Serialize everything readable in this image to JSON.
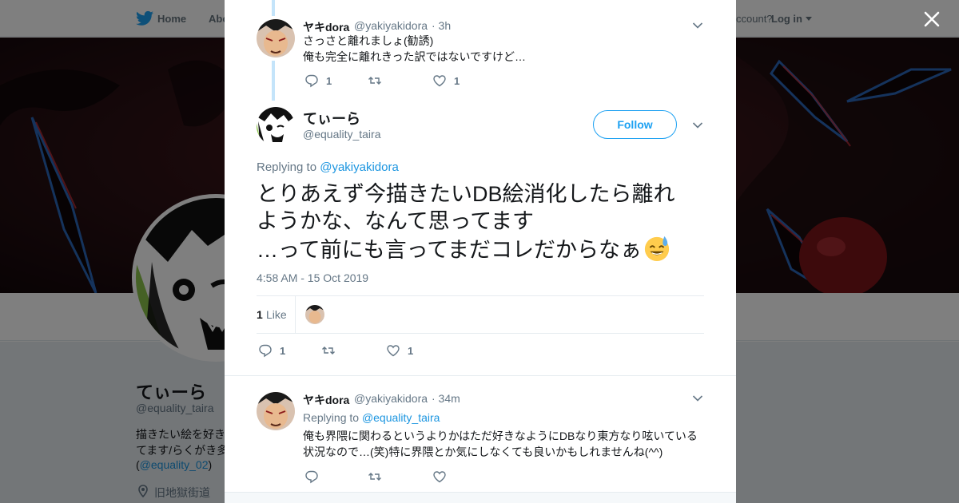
{
  "nav": {
    "home_label": "Home",
    "about_label": "Abo",
    "account_text": "ccount?",
    "login_label": "Log in"
  },
  "profile": {
    "name": "てぃーら",
    "handle": "@equality_taira",
    "bio_line1": "描きたい絵を好き",
    "bio_line2": "てます/らくがき多",
    "bio_prefix": "(",
    "bio_link": "@equality_02",
    "bio_suffix": ")",
    "location": "旧地獄街道"
  },
  "modal": {
    "parent_tweet": {
      "name": "ヤキdora",
      "handle": "@yakiyakidora",
      "time": "· 3h",
      "line1": "さっさと離れましょ(勧誘)",
      "line2": "俺も完全に離れきった訳ではないですけど…",
      "reply_count": "1",
      "like_count": "1"
    },
    "main_tweet": {
      "name": "てぃーら",
      "handle": "@equality_taira",
      "follow_label": "Follow",
      "replying_prefix": "Replying to",
      "replying_to": "@yakiyakidora",
      "line1": "とりあえず今描きたいDB絵消化したら離れ",
      "line2": "ようかな、なんて思ってます",
      "line3": "…って前にも言ってまだコレだからなぁ",
      "timestamp": "4:58 AM - 15 Oct 2019",
      "likes_count": "1",
      "likes_label": "Like",
      "reply_count": "1",
      "like_count": "1"
    },
    "reply_tweet": {
      "name": "ヤキdora",
      "handle": "@yakiyakidora",
      "time": "· 34m",
      "replying_prefix": "Replying to",
      "replying_to": "@equality_taira",
      "line1": "俺も界隈に関わるというよりかはただ好きなようにDBなり東方なり呟いている",
      "line2": "状況なので…(笑)特に界隈とか気にしなくても良いかもしれませんね(^^)"
    }
  },
  "colors": {
    "accent": "#1da1f2",
    "link": "#1b95e0",
    "secondary_text": "#657786",
    "thread_line": "#c4e4fa"
  },
  "icons": [
    "twitter-bird-icon",
    "close-icon",
    "chevron-down-icon",
    "reply-icon",
    "retweet-icon",
    "heart-icon",
    "location-pin-icon",
    "sweat-smile-emoji"
  ]
}
